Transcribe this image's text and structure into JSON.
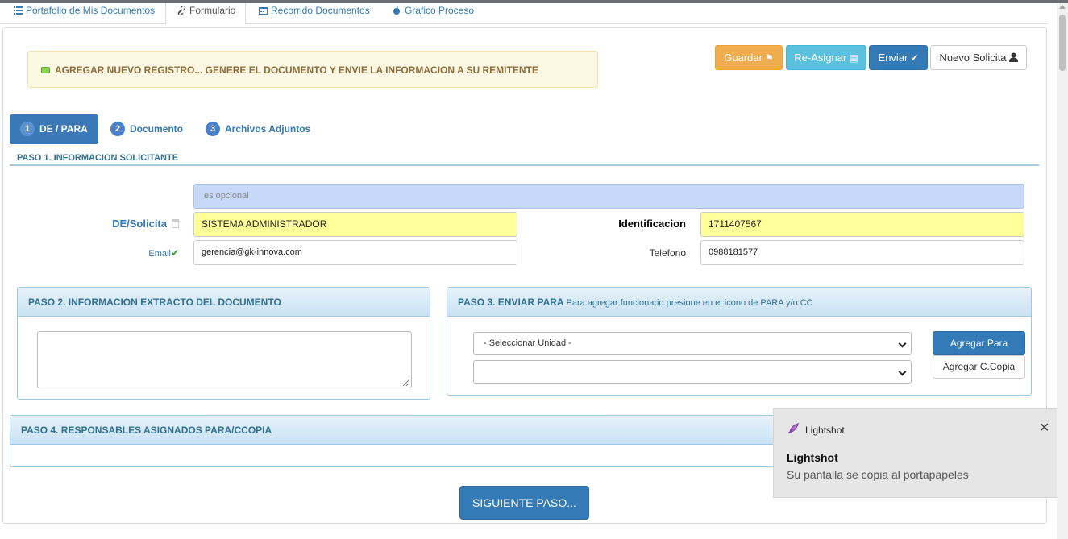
{
  "tabs": [
    {
      "label": "Portafolio de Mis Documentos",
      "icon": "list-icon"
    },
    {
      "label": "Formulario",
      "icon": "link-icon"
    },
    {
      "label": "Recorrido Documentos",
      "icon": "calendar-icon"
    },
    {
      "label": "Grafico Proceso",
      "icon": "apple-icon"
    }
  ],
  "alert": {
    "text": "AGREGAR NUEVO REGISTRO... GENERE EL DOCUMENTO Y ENVIE LA INFORMACION A SU REMITENTE"
  },
  "toolbar": {
    "guardar": "Guardar",
    "reasignar": "Re-Asignar",
    "enviar": "Enviar",
    "nuevo": "Nuevo Solicita"
  },
  "steps": [
    {
      "num": "1",
      "label": "DE / PARA"
    },
    {
      "num": "2",
      "label": "Documento"
    },
    {
      "num": "3",
      "label": "Archivos Adjuntos"
    }
  ],
  "paso1": {
    "title": "PASO 1. INFORMACION SOLICITANTE",
    "optional_placeholder": "es opcional",
    "de_label": "DE/Solicita",
    "de_value": "SISTEMA ADMINISTRADOR",
    "email_label": "Email",
    "email_value": "gerencia@gk-innova.com",
    "ident_label": "Identificacion",
    "ident_value": "1711407567",
    "tel_label": "Telefono",
    "tel_value": "0988181577"
  },
  "paso2": {
    "title": "PASO 2. INFORMACION EXTRACTO DEL DOCUMENTO",
    "text": ""
  },
  "paso3": {
    "title": "PASO 3. ENVIAR PARA",
    "hint": "Para agregar funcionario presione en el icono de PARA y/o CC",
    "unidad_selected": "- Seleccionar Unidad -",
    "second_selected": "",
    "agregar_para": "Agregar Para",
    "agregar_copia": "Agregar C.Copia"
  },
  "paso4": {
    "title": "PASO 4. RESPONSABLES ASIGNADOS PARA/CCOPIA"
  },
  "next_button": "SIGUIENTE PASO...",
  "toast": {
    "app": "Lightshot",
    "title": "Lightshot",
    "message": "Su pantalla se copia al portapapeles",
    "close": "✕"
  },
  "colors": {
    "primary": "#337ab7",
    "warning": "#f0ad4e",
    "info": "#5bc0de",
    "highlight": "#ffff99"
  }
}
